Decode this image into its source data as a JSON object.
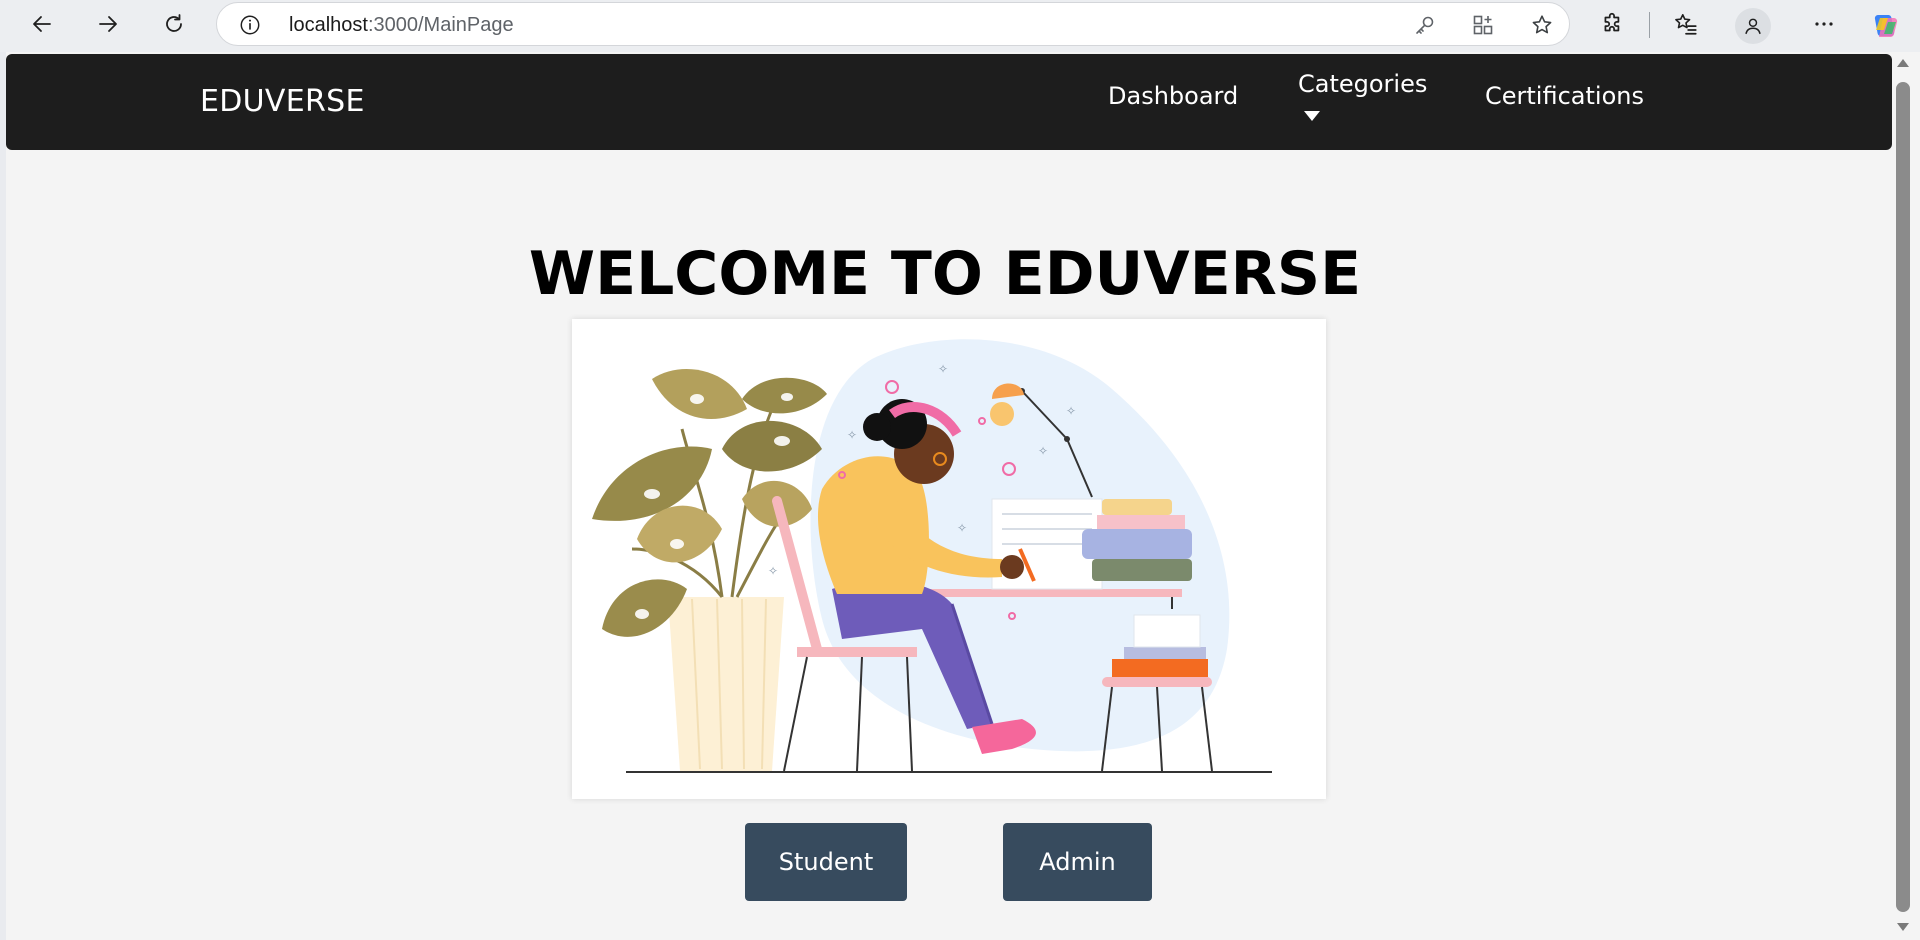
{
  "browser": {
    "url_host": "localhost",
    "url_path": ":3000/MainPage",
    "icons": [
      "back-icon",
      "forward-icon",
      "refresh-icon",
      "info-icon",
      "key-icon",
      "app-grid-icon",
      "favorite-star-icon",
      "extensions-icon",
      "favorites-list-icon",
      "profile-icon",
      "more-icon",
      "copilot-icon"
    ]
  },
  "app": {
    "brand": "EDUVERSE",
    "nav": {
      "dashboard": "Dashboard",
      "categories": "Categories",
      "certifications": "Certifications"
    },
    "welcome_title": "WELCOME TO EDUVERSE",
    "buttons": {
      "student": "Student",
      "admin": "Admin"
    }
  },
  "colors": {
    "navbar_bg": "#1d1d1d",
    "page_bg": "#f4f4f4",
    "button_bg": "#374b5e"
  }
}
